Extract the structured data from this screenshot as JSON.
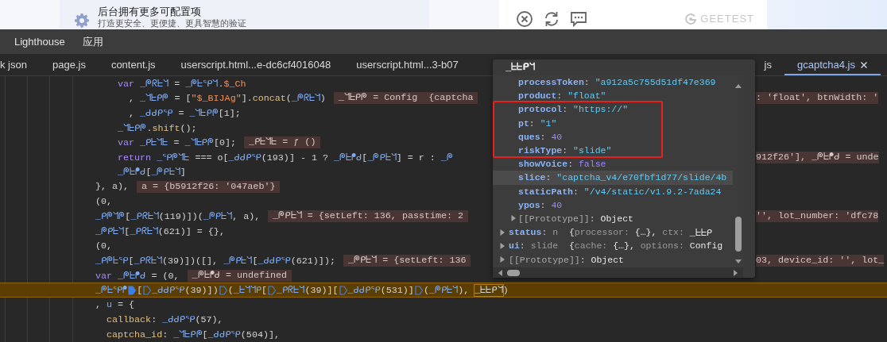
{
  "page": {
    "notice": {
      "title": "后台拥有更多可配置项",
      "subtitle": "打造更安全、更便捷、更具智慧的验证"
    },
    "captcha_card": {
      "brand": "GEETEST"
    }
  },
  "devtools": {
    "menu": [
      {
        "label": "Lighthouse"
      },
      {
        "label": "应用"
      }
    ],
    "tabs": [
      {
        "label": "k json",
        "selected": false
      },
      {
        "label": "page.js",
        "selected": false
      },
      {
        "label": "content.js",
        "selected": false
      },
      {
        "label": "userscript.html...e-dc6cf4016048",
        "selected": false
      },
      {
        "label": "userscript.html...3-b07",
        "selected": false
      },
      {
        "label": "js",
        "selected": false
      },
      {
        "label": "gcaptcha4.js",
        "selected": true
      }
    ],
    "code_lines": [
      {
        "children": [
          {
            "children": [
              {
                "segments": [
                  {
                    "kind": "code",
                    "parts": [
                      {
                        "t": "var ",
                        "kind": "kw"
                      },
                      {
                        "t": "_ᖘᖇᖶᖻ",
                        "kind": "id"
                      },
                      {
                        "t": " = ",
                        "kind": "plain"
                      },
                      {
                        "t": "_ᖘᖶᕿᖻ",
                        "kind": "id"
                      },
                      {
                        "t": ".",
                        "kind": "plain"
                      },
                      {
                        "t": "$_Ch",
                        "kind": "str"
                      }
                    ]
                  }
                ],
                "children": [
                  {
                    "segments": [
                      {
                        "kind": "code",
                        "parts": [
                          {
                            "t": ", ",
                            "kind": "plain"
                          },
                          {
                            "t": "_ᖻᖶᑭᖘ",
                            "kind": "id"
                          },
                          {
                            "t": " = [",
                            "kind": "plain"
                          },
                          {
                            "t": "\"$_BIJAg\"",
                            "kind": "str"
                          },
                          {
                            "t": "].",
                            "kind": "plain"
                          },
                          {
                            "t": "concat",
                            "kind": "fn"
                          },
                          {
                            "t": "(",
                            "kind": "plain"
                          },
                          {
                            "t": "_ᖘᖇᖶᖻ",
                            "kind": "id"
                          },
                          {
                            "t": ")",
                            "kind": "plain"
                          }
                        ]
                      },
                      {
                        "kind": "value",
                        "text": "_ᖻᖶᑭᖘ = Config  {captcha"
                      }
                    ],
                    "right_segments": [
                      {
                        "kind": "value",
                        "text": ": 'float', btnWidth: '"
                      }
                    ]
                  },
                  {
                    "segments": [
                      {
                        "kind": "code",
                        "parts": [
                          {
                            "t": ", ",
                            "kind": "plain"
                          },
                          {
                            "t": "_ᑯᑯᑭᕿ",
                            "kind": "id"
                          },
                          {
                            "t": " = ",
                            "kind": "plain"
                          },
                          {
                            "t": "_ᖻᖶᑭᖘ",
                            "kind": "id"
                          },
                          {
                            "t": "[1];",
                            "kind": "plain"
                          }
                        ]
                      }
                    ]
                  }
                ]
              },
              {
                "segments": [
                  {
                    "kind": "code",
                    "parts": [
                      {
                        "t": "_ᖻᖶᑭᖘ",
                        "kind": "id"
                      },
                      {
                        "t": ".",
                        "kind": "plain"
                      },
                      {
                        "t": "shift",
                        "kind": "fn"
                      },
                      {
                        "t": "();",
                        "kind": "plain"
                      }
                    ]
                  }
                ]
              },
              {
                "segments": [
                  {
                    "kind": "code",
                    "parts": [
                      {
                        "t": "var ",
                        "kind": "kw"
                      },
                      {
                        "t": "_ᑭᖶᖻᖶ",
                        "kind": "id"
                      },
                      {
                        "t": " = ",
                        "kind": "plain"
                      },
                      {
                        "t": "_ᖻᖶᑭᖘ",
                        "kind": "id"
                      },
                      {
                        "t": "[0];",
                        "kind": "plain"
                      }
                    ]
                  },
                  {
                    "kind": "value",
                    "text": "_ᑭᖶᖻᖶ = ƒ ()"
                  }
                ]
              },
              {
                "segments": [
                  {
                    "kind": "code",
                    "parts": [
                      {
                        "t": "return ",
                        "kind": "kw"
                      },
                      {
                        "t": "_ᕿᖘᖻᖶ",
                        "kind": "id"
                      },
                      {
                        "t": " === o[",
                        "kind": "plain"
                      },
                      {
                        "t": "_ᑯᑯᑭᕿ",
                        "kind": "id"
                      },
                      {
                        "t": "(193)] - 1 ? ",
                        "kind": "plain"
                      },
                      {
                        "t": "_ᖘᖶᖰᑯ",
                        "kind": "id"
                      },
                      {
                        "t": "[",
                        "kind": "plain"
                      },
                      {
                        "t": "_ᖘᑭᖶᖻ",
                        "kind": "id"
                      },
                      {
                        "t": "] = r : ",
                        "kind": "plain"
                      },
                      {
                        "t": "_ᖘ",
                        "kind": "id"
                      }
                    ]
                  }
                ],
                "right_segments": [
                  {
                    "kind": "value",
                    "text": "912f26'], _ᖘᖶᖰᑯ = unde"
                  }
                ]
              },
              {
                "segments": [
                  {
                    "kind": "code",
                    "parts": [
                      {
                        "t": "_ᖘᖶᖰᑯ",
                        "kind": "id"
                      },
                      {
                        "t": "[",
                        "kind": "plain"
                      },
                      {
                        "t": "_ᖘᑭᖶᖻ",
                        "kind": "id"
                      },
                      {
                        "t": "]",
                        "kind": "plain"
                      }
                    ]
                  }
                ]
              }
            ]
          }
        ]
      },
      {
        "segments": [
          {
            "kind": "code",
            "parts": [
              {
                "t": "}, a),",
                "kind": "plain"
              }
            ]
          },
          {
            "kind": "value",
            "text": "a = {b5912f26: '047aeb'}"
          }
        ]
      },
      {
        "segments": [
          {
            "kind": "code",
            "parts": [
              {
                "t": "(0,",
                "kind": "plain"
              }
            ]
          }
        ]
      },
      {
        "segments": [
          {
            "kind": "code",
            "parts": [
              {
                "t": "_ᑭᖘᖻᖘ",
                "kind": "id"
              },
              {
                "t": "[",
                "kind": "plain"
              },
              {
                "t": "_ᑭᖇᖶᖻ",
                "kind": "id"
              },
              {
                "t": "(119)])(",
                "kind": "plain"
              },
              {
                "t": "_ᖘᑭᖶᖻ",
                "kind": "id"
              },
              {
                "t": ", a),",
                "kind": "plain"
              }
            ]
          },
          {
            "kind": "value",
            "text": "_ᖘᑭᖶᖻ = {setLeft: 136, passtime: 2"
          }
        ],
        "right_segments": [
          {
            "kind": "value",
            "text": "'', lot_number: 'dfc78"
          }
        ]
      },
      {
        "segments": [
          {
            "kind": "code",
            "parts": [
              {
                "t": "_ᖘᑭᖶᖻ",
                "kind": "id"
              },
              {
                "t": "[",
                "kind": "plain"
              },
              {
                "t": "_ᑭᖇᖶᖻ",
                "kind": "id"
              },
              {
                "t": "(621)] = {},",
                "kind": "plain"
              }
            ]
          }
        ]
      },
      {
        "segments": [
          {
            "kind": "code",
            "parts": [
              {
                "t": "(0,",
                "kind": "plain"
              }
            ]
          }
        ]
      },
      {
        "segments": [
          {
            "kind": "code",
            "parts": [
              {
                "t": "_ᑭᖘᖶᕿ",
                "kind": "id"
              },
              {
                "t": "[",
                "kind": "plain"
              },
              {
                "t": "_ᑭᖇᖶᖻ",
                "kind": "id"
              },
              {
                "t": "(39)])([], ",
                "kind": "plain"
              },
              {
                "t": "_ᖘᑭᖶᖻ",
                "kind": "id"
              },
              {
                "t": "[",
                "kind": "plain"
              },
              {
                "t": "_ᑯᑯᑭᕿ",
                "kind": "id"
              },
              {
                "t": "(621)]);",
                "kind": "plain"
              }
            ]
          },
          {
            "kind": "value",
            "text": "_ᖘᑭᖶᖻ = {setLeft: 136"
          }
        ],
        "right_segments": [
          {
            "kind": "value",
            "text": "03, device_id: '', lot_"
          }
        ]
      },
      {
        "segments": [
          {
            "kind": "code",
            "parts": [
              {
                "t": "var ",
                "kind": "kw"
              },
              {
                "t": "_ᖘᖶᖰᑯ",
                "kind": "id"
              },
              {
                "t": " = (0,",
                "kind": "plain"
              }
            ]
          },
          {
            "kind": "value",
            "text": "_ᖘᖶᖰᑯ = undefined"
          }
        ]
      },
      {
        "highlighted": true,
        "segments": [
          {
            "kind": "code",
            "parts": [
              {
                "t": "_ᖘᖶᕿᖰ",
                "kind": "id"
              }
            ]
          },
          {
            "kind": "breakpoint",
            "active": true
          },
          {
            "kind": "code",
            "parts": [
              {
                "t": "[",
                "kind": "plain"
              }
            ]
          },
          {
            "kind": "breakpoint",
            "active": false
          },
          {
            "kind": "code",
            "parts": [
              {
                "t": "_ᑯᑯᑭᕿ",
                "kind": "id"
              },
              {
                "t": "(39)])",
                "kind": "plain"
              }
            ]
          },
          {
            "kind": "breakpoint",
            "active": false
          },
          {
            "kind": "code",
            "parts": [
              {
                "t": "(",
                "kind": "plain"
              },
              {
                "t": "_ᖶᖻᖻᑭ",
                "kind": "id"
              },
              {
                "t": "[",
                "kind": "plain"
              }
            ]
          },
          {
            "kind": "breakpoint",
            "active": false
          },
          {
            "kind": "code",
            "parts": [
              {
                "t": "_ᑭᖇᖶᖻ",
                "kind": "id"
              },
              {
                "t": "(39)][",
                "kind": "plain"
              }
            ]
          },
          {
            "kind": "breakpoint",
            "active": false
          },
          {
            "kind": "code",
            "parts": [
              {
                "t": "_ᑯᑯᑭᕿ",
                "kind": "id"
              },
              {
                "t": "(531)]",
                "kind": "plain"
              }
            ]
          },
          {
            "kind": "breakpoint",
            "active": false
          },
          {
            "kind": "code",
            "parts": [
              {
                "t": "(",
                "kind": "plain"
              },
              {
                "t": "_ᖘᑭᖶᖻ",
                "kind": "id"
              },
              {
                "t": "), ",
                "kind": "plain"
              },
              {
                "t": "_ᖶᖶᑭᖻ",
                "kind": "boxed"
              },
              {
                "t": ")",
                "kind": "plain"
              }
            ]
          }
        ]
      },
      {
        "segments": [
          {
            "kind": "code",
            "parts": [
              {
                "t": ", ",
                "kind": "plain"
              },
              {
                "t": "u",
                "kind": "id"
              },
              {
                "t": " = {",
                "kind": "plain"
              }
            ]
          }
        ],
        "children": [
          {
            "segments": [
              {
                "kind": "code",
                "parts": [
                  {
                    "t": "callback",
                    "kind": "prop"
                  },
                  {
                    "t": ": ",
                    "kind": "plain"
                  },
                  {
                    "t": "_ᑯᑯᑭᕿ",
                    "kind": "id"
                  },
                  {
                    "t": "(57),",
                    "kind": "plain"
                  }
                ]
              }
            ]
          },
          {
            "segments": [
              {
                "kind": "code",
                "parts": [
                  {
                    "t": "captcha_id",
                    "kind": "prop"
                  },
                  {
                    "t": ": ",
                    "kind": "plain"
                  },
                  {
                    "t": "_ᖻᖶᑭᖘ",
                    "kind": "id"
                  },
                  {
                    "t": "[",
                    "kind": "plain"
                  },
                  {
                    "t": "_ᑯᑯᑭᕿ",
                    "kind": "id"
                  },
                  {
                    "t": "(504)],",
                    "kind": "plain"
                  }
                ]
              }
            ]
          }
        ]
      }
    ],
    "hover_popup": {
      "title": "_ᖶᖶᑭᖻ",
      "inner_properties": [
        {
          "key": "processToken",
          "kind": "property",
          "selected": false,
          "value": [
            {
              "t": ": ",
              "kind": "punct"
            },
            {
              "t": "\"a912a5c755d51df47e369",
              "kind": "str"
            }
          ]
        },
        {
          "key": "product",
          "kind": "property",
          "selected": false,
          "value": [
            {
              "t": ": ",
              "kind": "punct"
            },
            {
              "t": "\"float\"",
              "kind": "str"
            }
          ]
        },
        {
          "key": "protocol",
          "kind": "property",
          "selected": false,
          "value": [
            {
              "t": ": ",
              "kind": "punct"
            },
            {
              "t": "\"https://\"",
              "kind": "str"
            }
          ]
        },
        {
          "key": "pt",
          "kind": "property",
          "selected": false,
          "value": [
            {
              "t": ": ",
              "kind": "punct"
            },
            {
              "t": "\"1\"",
              "kind": "str"
            }
          ]
        },
        {
          "key": "ques",
          "kind": "property",
          "selected": false,
          "value": [
            {
              "t": ": ",
              "kind": "punct"
            },
            {
              "t": "40",
              "kind": "num"
            }
          ]
        },
        {
          "key": "riskType",
          "kind": "property",
          "selected": false,
          "value": [
            {
              "t": ": ",
              "kind": "punct"
            },
            {
              "t": "\"slide\"",
              "kind": "str"
            }
          ]
        },
        {
          "key": "showVoice",
          "kind": "property",
          "selected": false,
          "value": [
            {
              "t": ": ",
              "kind": "punct"
            },
            {
              "t": "false",
              "kind": "num"
            }
          ]
        },
        {
          "key": "slice",
          "kind": "property",
          "selected": true,
          "value": [
            {
              "t": ": ",
              "kind": "punct"
            },
            {
              "t": "\"captcha_v4/e70fbf1d77/slide/4b",
              "kind": "str"
            }
          ]
        },
        {
          "key": "staticPath",
          "kind": "property",
          "selected": false,
          "value": [
            {
              "t": ": ",
              "kind": "punct"
            },
            {
              "t": "\"/v4/static/v1.9.2-7ada24",
              "kind": "str"
            }
          ]
        },
        {
          "key": "ypos",
          "kind": "property",
          "selected": false,
          "value": [
            {
              "t": ": ",
              "kind": "punct"
            },
            {
              "t": "40",
              "kind": "num"
            }
          ]
        },
        {
          "key": "[[Prototype]]",
          "kind": "internal",
          "selected": false,
          "expanded": false,
          "value": [
            {
              "t": ": ",
              "kind": "punct"
            },
            {
              "t": "Object",
              "kind": "plain"
            }
          ]
        }
      ],
      "properties": [
        {
          "key": "status",
          "kind": "property",
          "selected": false,
          "expanded": false,
          "value": [
            {
              "t": ": ",
              "kind": "punct"
            },
            {
              "t": "n",
              "kind": "dim"
            },
            {
              "t": "  {",
              "kind": "plain"
            },
            {
              "t": "processor: ",
              "kind": "dim"
            },
            {
              "t": "{…}, ",
              "kind": "plain"
            },
            {
              "t": "ctx: ",
              "kind": "dim"
            },
            {
              "t": "_ᖶᖶᑭ",
              "kind": "plain"
            }
          ]
        },
        {
          "key": "ui",
          "kind": "property",
          "selected": false,
          "expanded": false,
          "value": [
            {
              "t": ": ",
              "kind": "punct"
            },
            {
              "t": "slide",
              "kind": "dim"
            },
            {
              "t": "  {",
              "kind": "plain"
            },
            {
              "t": "cache: ",
              "kind": "dim"
            },
            {
              "t": "{…}, ",
              "kind": "plain"
            },
            {
              "t": "options: ",
              "kind": "dim"
            },
            {
              "t": "Config",
              "kind": "plain"
            }
          ]
        },
        {
          "key": "[[Prototype]]",
          "kind": "internal",
          "selected": false,
          "expanded": false,
          "value": [
            {
              "t": ": ",
              "kind": "punct"
            },
            {
              "t": "Object",
              "kind": "plain"
            }
          ]
        }
      ]
    }
  }
}
